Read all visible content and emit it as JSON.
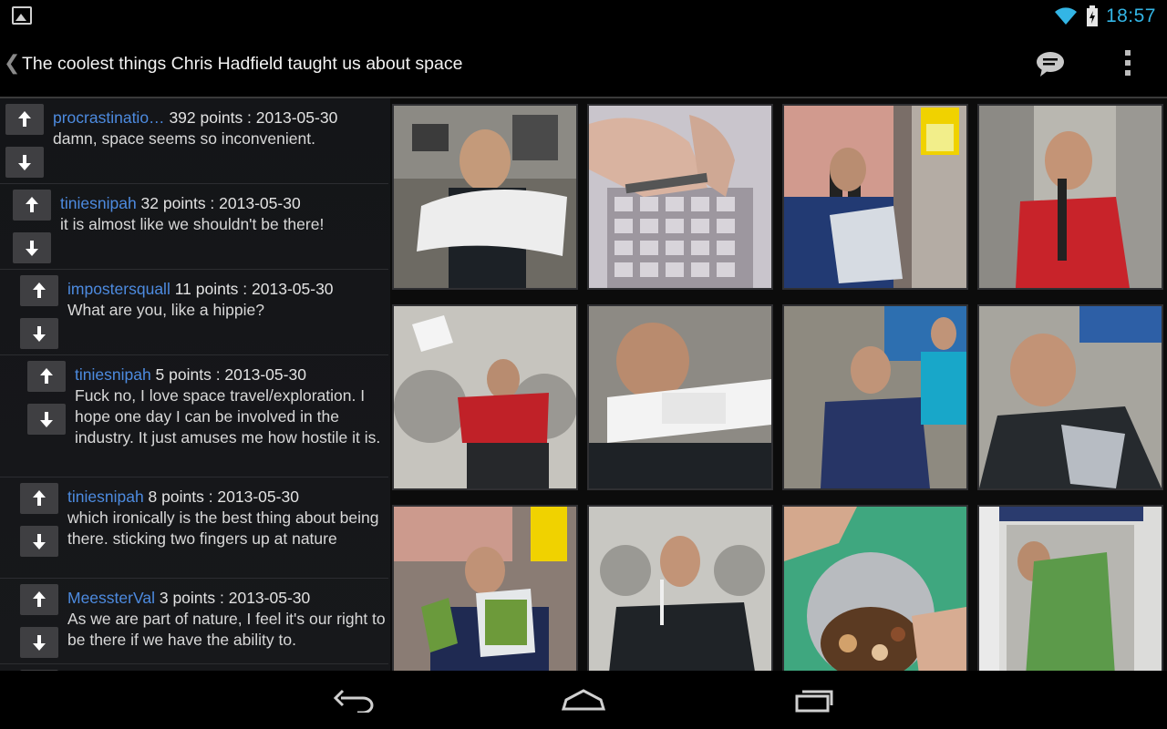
{
  "status_bar": {
    "notification_icon": "gallery-icon",
    "wifi_icon": "wifi-icon",
    "battery_icon": "battery-charging-icon",
    "time": "18:57",
    "time_color": "#33b5e5"
  },
  "action_bar": {
    "back_caret": "❮",
    "title": "The coolest things Chris Hadfield taught us about space",
    "comments_icon": "comments-icon",
    "overflow_icon": "overflow-menu-icon"
  },
  "comments": [
    {
      "author": "procrastinatio…",
      "meta": "392 points : 2013-05-30",
      "body": "damn, space seems so inconvenient."
    },
    {
      "author": "tiniesnipah",
      "meta": "32 points : 2013-05-30",
      "body": "it is almost like we shouldn't be there!"
    },
    {
      "author": "impostersquall",
      "meta": "11 points : 2013-05-30",
      "body": "What are you, like a hippie?"
    },
    {
      "author": "tiniesnipah",
      "meta": "5 points : 2013-05-30",
      "body": "Fuck no, I love space travel/exploration. I hope one day I can be involved in the industry. It just amuses me how hostile it is."
    },
    {
      "author": "tiniesnipah",
      "meta": "8 points : 2013-05-30",
      "body": "which ironically is the best thing about being there. sticking two fingers up at nature"
    },
    {
      "author": "MeessterVal",
      "meta": "3 points : 2013-05-30",
      "body": "As we are part of nature, I feel it's our right to be there if we have the ability to."
    }
  ],
  "author_color": "#4d8be0",
  "gallery": {
    "tiles": [
      {
        "name": "hadfield-wringing-towel"
      },
      {
        "name": "nail-clippers-on-grate"
      },
      {
        "name": "speed-limit-17500-food-bag"
      },
      {
        "name": "hadfield-red-shirt-microphone"
      },
      {
        "name": "hadfield-red-shirt-tissue"
      },
      {
        "name": "astroglide-tube"
      },
      {
        "name": "crew-eating-module"
      },
      {
        "name": "hadfield-eating-pouch"
      },
      {
        "name": "hadfield-spinach-pouch"
      },
      {
        "name": "hadfield-straw-drink"
      },
      {
        "name": "nuts-can-closeup"
      },
      {
        "name": "sleeping-bag-crew-quarters"
      }
    ]
  },
  "nav_bar": {
    "back": "nav-back-icon",
    "home": "nav-home-icon",
    "recents": "nav-recents-icon"
  }
}
